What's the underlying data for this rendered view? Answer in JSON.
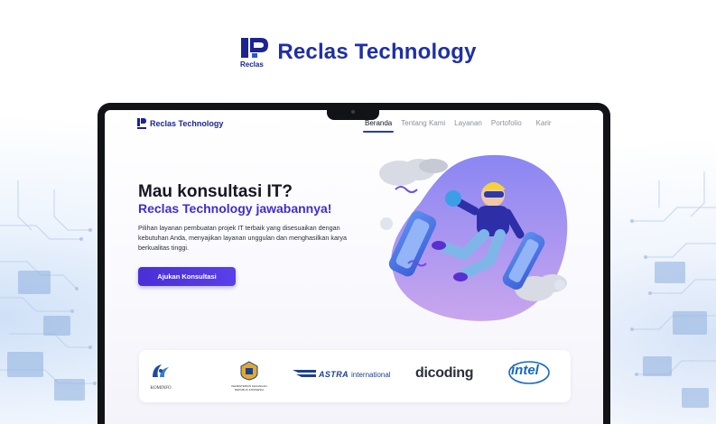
{
  "brand": {
    "top_name": "Reclas Technology",
    "logo_caption": "Reclas",
    "color": "#1b2490"
  },
  "nav": {
    "brand": "Reclas Technology",
    "links": [
      {
        "label": "Beranda",
        "active": true
      },
      {
        "label": "Tentang Kami",
        "active": false
      },
      {
        "label": "Layanan",
        "active": false
      },
      {
        "label": "Portofolio",
        "active": false
      },
      {
        "label": "Karir",
        "active": false
      }
    ]
  },
  "hero": {
    "title": "Mau konsultasi IT?",
    "subtitle": "Reclas Technology jawabannya!",
    "description": "Pilihan layanan pembuatan projek IT terbaik yang disesuaikan dengan kebutuhan Anda, menyajikan layanan unggulan dan menghasilkan karya berkualitas tinggi.",
    "cta_label": "Ajukan Konsultasi",
    "accent": "#4a2fd6"
  },
  "partners": [
    {
      "name": "KOMINFO",
      "icon": "kominfo-logo"
    },
    {
      "name": "KEMENTERIAN KEUANGAN REPUBLIK INDONESIA",
      "icon": "kemenkeu-logo"
    },
    {
      "name": "ASTRA",
      "suffix": "international",
      "icon": "astra-logo"
    },
    {
      "name": "dicoding",
      "icon": "dicoding-logo"
    },
    {
      "name": "intel",
      "icon": "intel-logo"
    }
  ]
}
